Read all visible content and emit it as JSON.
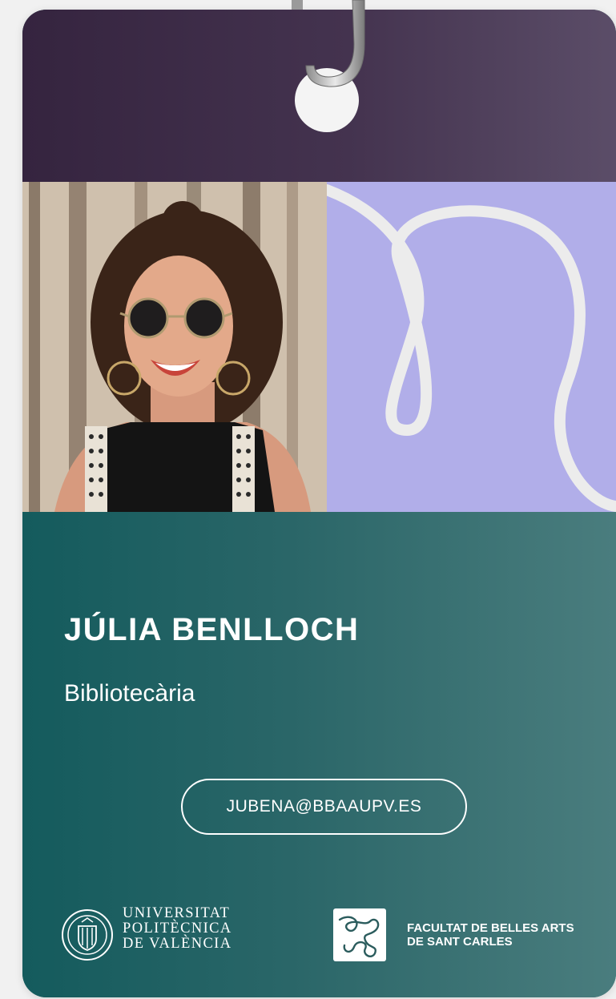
{
  "person": {
    "name": "JÚLIA BENLLOCH",
    "role": "Bibliotecària",
    "email": "JUBENA@BBAAUPV.ES"
  },
  "logos": {
    "upv": [
      "UNIVERSITAT",
      "POLITÈCNICA",
      "DE VALÈNCIA"
    ],
    "faculty": [
      "FACULTAT DE BELLES ARTS",
      "DE SANT CARLES"
    ]
  },
  "colors": {
    "top_band": "#3f2d49",
    "pattern_bg": "#b1aee9",
    "bottom_band": "#1e5f62",
    "text": "#ffffff"
  },
  "icons": {
    "lanyard_hook": "metal-clip-icon",
    "upv_seal": "university-seal-icon",
    "faculty_mark": "squiggle-logo-icon"
  }
}
